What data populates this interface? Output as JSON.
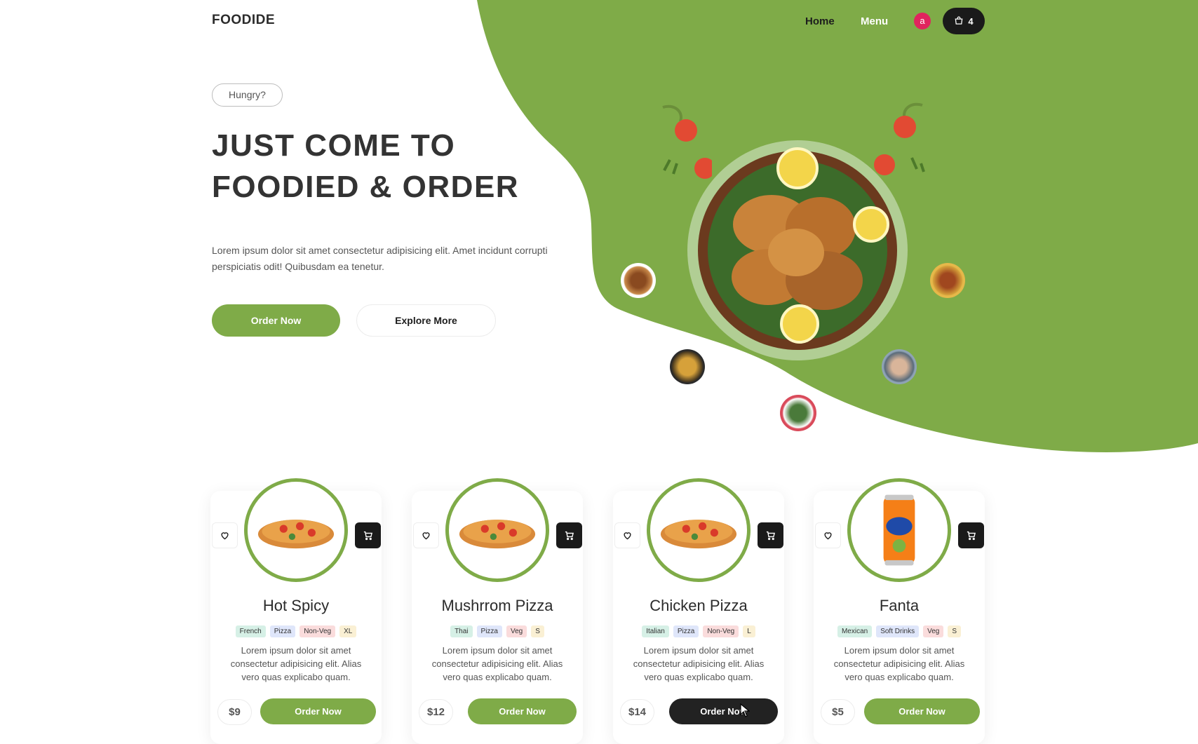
{
  "header": {
    "logo": "FOODIDE",
    "nav": [
      {
        "label": "Home"
      },
      {
        "label": "Menu"
      }
    ],
    "avatar_letter": "a",
    "cart_count": "4"
  },
  "hero": {
    "badge": "Hungry?",
    "title_line1": "JUST COME TO",
    "title_line2": "FOODIED & ORDER",
    "description": "Lorem ipsum dolor sit amet consectetur adipisicing elit. Amet incidunt corrupti perspiciatis odit! Quibusdam ea tenetur.",
    "primary_button": "Order Now",
    "secondary_button": "Explore More"
  },
  "products": [
    {
      "name": "Hot Spicy",
      "tags": [
        "French",
        "Pizza",
        "Non-Veg",
        "XL"
      ],
      "description": "Lorem ipsum dolor sit amet consectetur adipisicing elit. Alias vero quas explicabo quam.",
      "price": "$9",
      "button": "Order Now",
      "image": "pizza-image"
    },
    {
      "name": "Mushrrom Pizza",
      "tags": [
        "Thai",
        "Pizza",
        "Veg",
        "S"
      ],
      "description": "Lorem ipsum dolor sit amet consectetur adipisicing elit. Alias vero quas explicabo quam.",
      "price": "$12",
      "button": "Order Now",
      "image": "pizza-image"
    },
    {
      "name": "Chicken Pizza",
      "tags": [
        "Italian",
        "Pizza",
        "Non-Veg",
        "L"
      ],
      "description": "Lorem ipsum dolor sit amet consectetur adipisicing elit. Alias vero quas explicabo quam.",
      "price": "$14",
      "button": "Order Now",
      "image": "pizza-image"
    },
    {
      "name": "Fanta",
      "tags": [
        "Mexican",
        "Soft Drinks",
        "Veg",
        "S"
      ],
      "description": "Lorem ipsum dolor sit amet consectetur adipisicing elit. Alias vero quas explicabo quam.",
      "price": "$5",
      "button": "Order Now",
      "image": "fanta-can-image"
    }
  ],
  "colors": {
    "brand_green": "#7fab48",
    "dark": "#1a1a1a",
    "avatar": "#e0245e"
  },
  "icons": [
    "cart-icon",
    "heart-icon",
    "cursor-icon"
  ]
}
